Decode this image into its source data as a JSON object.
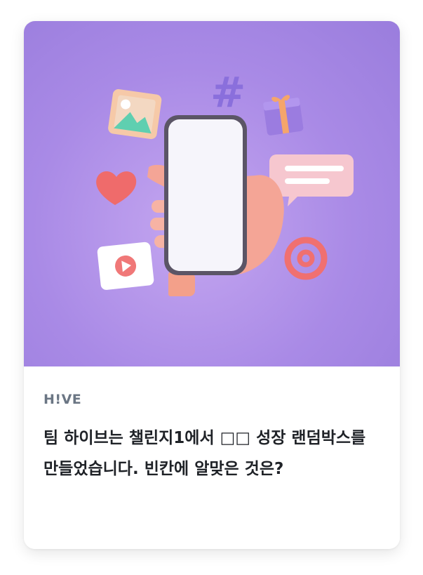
{
  "card": {
    "source": "H!VE",
    "title": "팀 하이브는 챌린지1에서 □□ 성장 랜덤박스를 만들었습니다. 빈칸에 알맞은 것은?"
  },
  "hero": {
    "icons": [
      "smartphone-icon",
      "hand-icon",
      "image-icon",
      "hashtag-icon",
      "gift-icon",
      "chat-bubble-icon",
      "heart-icon",
      "play-video-icon",
      "at-sign-icon",
      "thumbs-up-icon"
    ],
    "colors": {
      "background": "#a98ae6",
      "accent": "#f08a8a"
    }
  }
}
